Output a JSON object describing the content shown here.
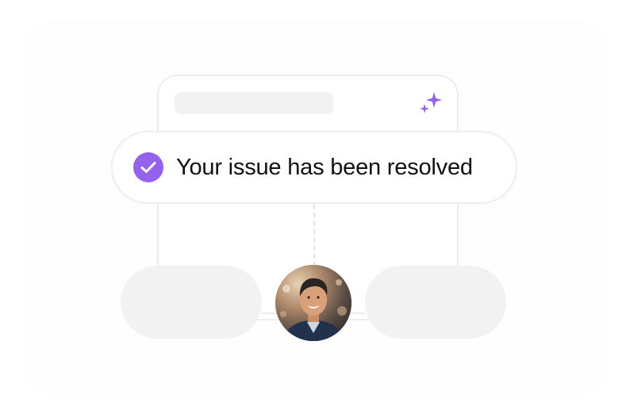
{
  "notification": {
    "message": "Your issue has been resolved",
    "icon": "check-circle-icon",
    "accent_color": "#9562EE"
  },
  "decor": {
    "sparkle_icon": "sparkles-icon",
    "sparkle_color": "#9562EE"
  },
  "avatar": {
    "icon": "user-avatar"
  }
}
